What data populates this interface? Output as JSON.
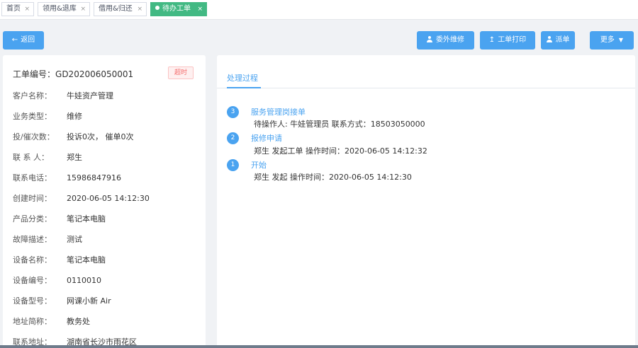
{
  "tabs": [
    {
      "label": "首页",
      "active": false
    },
    {
      "label": "领用&退库",
      "active": false
    },
    {
      "label": "借用&归还",
      "active": false
    },
    {
      "label": "待办工单",
      "active": true
    }
  ],
  "tab_close": "×",
  "toolbar": {
    "back": "返回",
    "outsource": "委外维修",
    "print": "工单打印",
    "dispatch": "派单",
    "more": "更多"
  },
  "order": {
    "label": "工单编号：",
    "number": "GD202006050001",
    "badge": "超时"
  },
  "details": [
    {
      "label": "客户名称：",
      "value": "牛娃资产管理"
    },
    {
      "label": "业务类型：",
      "value": "维修"
    },
    {
      "label": "投/催次数：",
      "value": "投诉0次， 催单0次"
    },
    {
      "label": "联 系 人：",
      "value": "郑生"
    },
    {
      "label": "联系电话：",
      "value": "15986847916"
    },
    {
      "label": "创建时间：",
      "value": "2020-06-05 14:12:30"
    },
    {
      "label": "产品分类：",
      "value": "笔记本电脑"
    },
    {
      "label": "故障描述：",
      "value": "测试"
    },
    {
      "label": "设备名称：",
      "value": "笔记本电脑"
    },
    {
      "label": "设备编号：",
      "value": "0110010"
    },
    {
      "label": "设备型号：",
      "value": "网课小新 Air"
    },
    {
      "label": "地址简称：",
      "value": "教务处"
    },
    {
      "label": "联系地址：",
      "value": "湖南省长沙市雨花区"
    }
  ],
  "process": {
    "tab": "处理过程",
    "steps": [
      {
        "num": "3",
        "title": "服务管理岗接单",
        "desc": "待操作人: 牛娃管理员 联系方式：18503050000"
      },
      {
        "num": "2",
        "title": "报修申请",
        "desc": "郑生 发起工单 操作时间：2020-06-05 14:12:32"
      },
      {
        "num": "1",
        "title": "开始",
        "desc": "郑生 发起 操作时间：2020-06-05 14:12:30"
      }
    ]
  },
  "colors": {
    "primary": "#4aa3f0",
    "active_tab": "#42b983",
    "danger": "#f56c6c"
  }
}
